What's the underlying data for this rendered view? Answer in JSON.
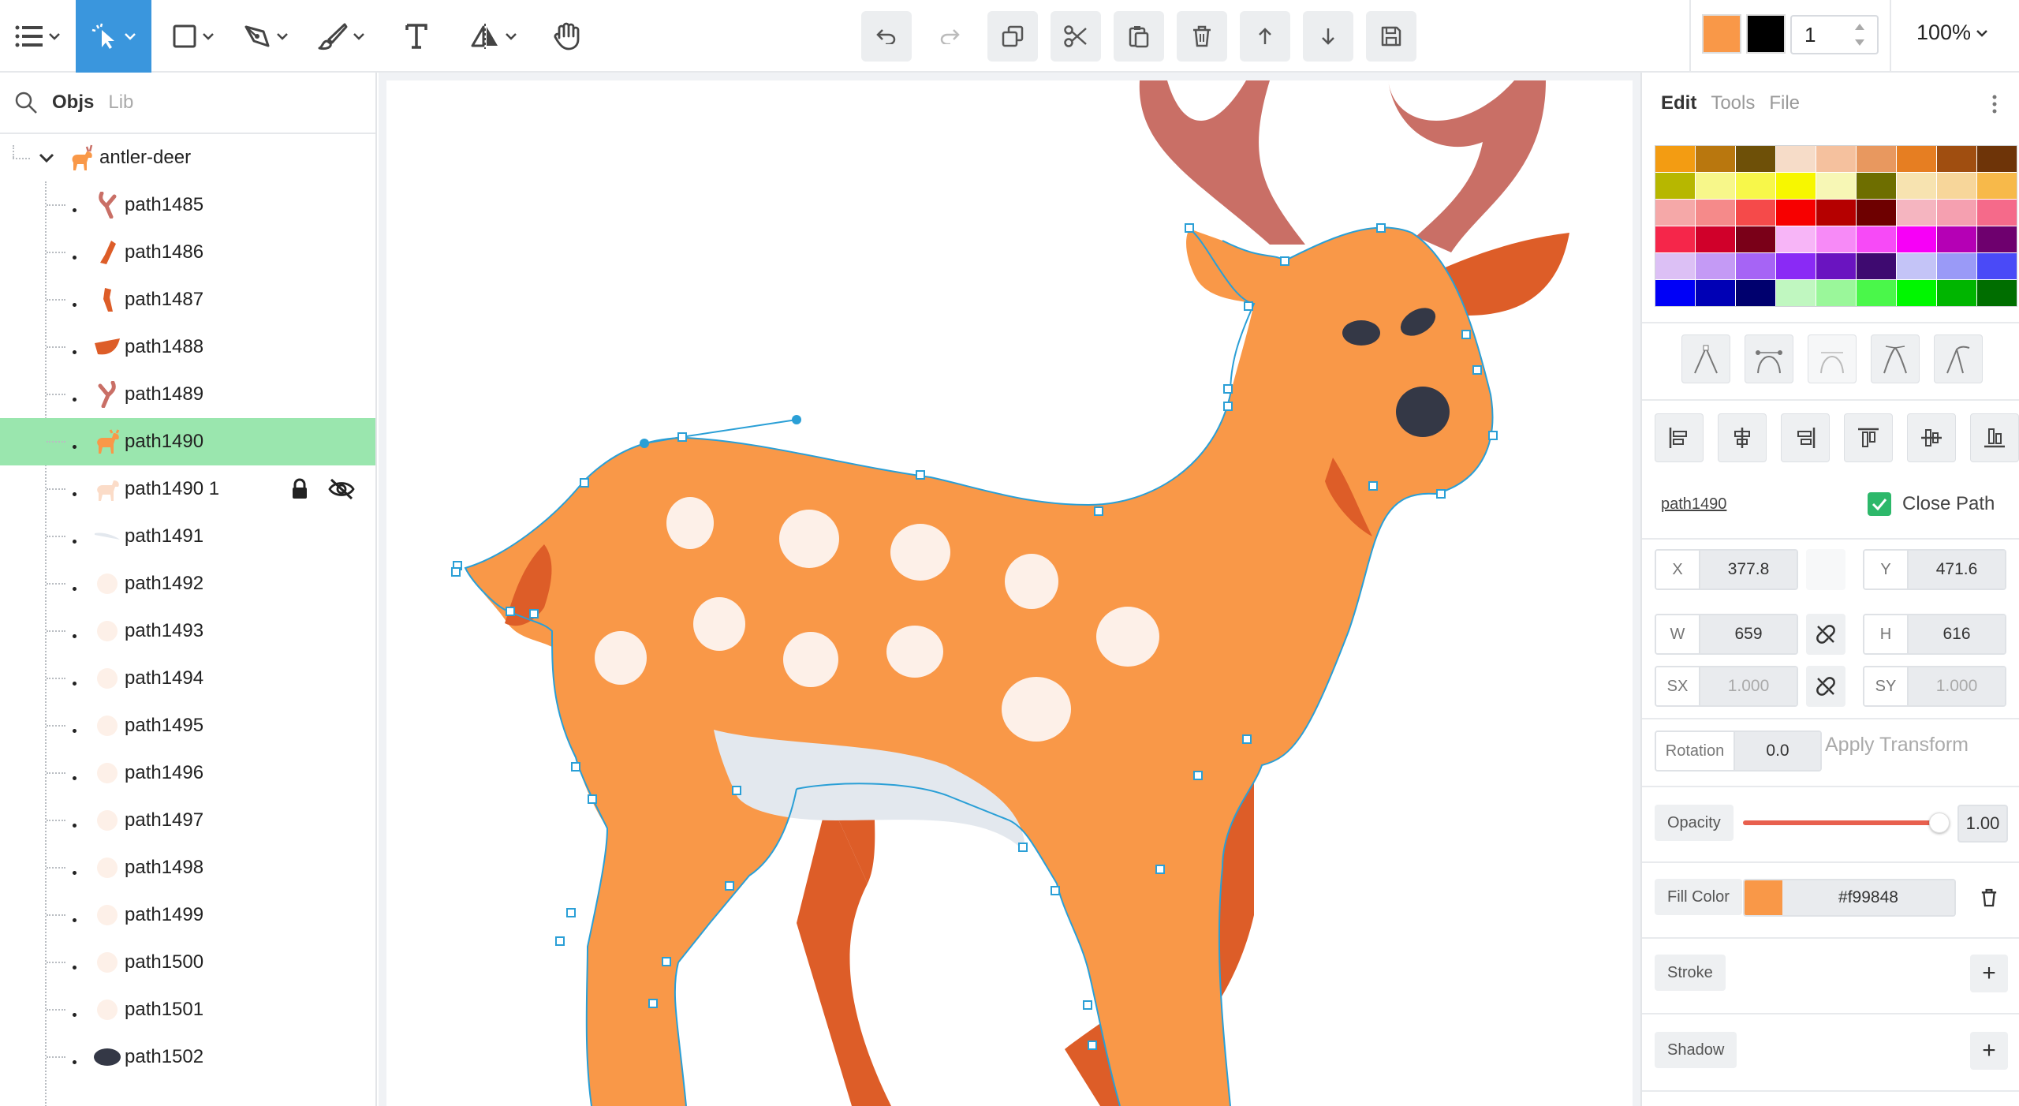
{
  "toolbar": {
    "stroke_width": "1",
    "zoom_label": "100%",
    "fill_color": "#f99848",
    "stroke_color": "#000000",
    "accent": "#3a96dd"
  },
  "left_panel": {
    "tabs": [
      "Objs",
      "Lib"
    ],
    "root": {
      "label": "antler-deer"
    },
    "items": [
      {
        "label": "path1485",
        "thumb": "antler-left"
      },
      {
        "label": "path1486",
        "thumb": "leg-dark"
      },
      {
        "label": "path1487",
        "thumb": "leg-dark-2"
      },
      {
        "label": "path1488",
        "thumb": "ear-shape"
      },
      {
        "label": "path1489",
        "thumb": "antler-right"
      },
      {
        "label": "path1490",
        "thumb": "deer-body",
        "selected": true
      },
      {
        "label": "path1490 1",
        "thumb": "deer-body-faded",
        "locked": true,
        "hidden": true
      },
      {
        "label": "path1491",
        "thumb": "belly"
      },
      {
        "label": "path1492",
        "thumb": "spot"
      },
      {
        "label": "path1493",
        "thumb": "spot"
      },
      {
        "label": "path1494",
        "thumb": "spot"
      },
      {
        "label": "path1495",
        "thumb": "spot"
      },
      {
        "label": "path1496",
        "thumb": "spot"
      },
      {
        "label": "path1497",
        "thumb": "spot"
      },
      {
        "label": "path1498",
        "thumb": "spot"
      },
      {
        "label": "path1499",
        "thumb": "spot"
      },
      {
        "label": "path1500",
        "thumb": "spot"
      },
      {
        "label": "path1501",
        "thumb": "spot"
      },
      {
        "label": "path1502",
        "thumb": "eye"
      }
    ]
  },
  "right_panel": {
    "tabs": [
      "Edit",
      "Tools",
      "File"
    ],
    "palette": [
      "#f39c12",
      "#b9770e",
      "#6e5008",
      "#f6dcc8",
      "#f5c19e",
      "#e8985f",
      "#e67e22",
      "#a04e10",
      "#6e3408",
      "#b7b700",
      "#f7f78a",
      "#f7f74a",
      "#f7f700",
      "#f7f7b5",
      "#6e6e00",
      "#f7e3b0",
      "#f7d69a",
      "#f7b94a",
      "#f5a8a8",
      "#f58a8a",
      "#f54a4a",
      "#f70000",
      "#b50000",
      "#6e0000",
      "#f5b5c0",
      "#f5a0b0",
      "#f56a8a",
      "#f5264a",
      "#d0002a",
      "#7a0018",
      "#f7b5f7",
      "#f78af7",
      "#f74af7",
      "#f700f7",
      "#b500b5",
      "#6e006e",
      "#dcc0f5",
      "#c49af5",
      "#a664f5",
      "#8a2af5",
      "#6a14c0",
      "#3e0a70",
      "#c4c4f7",
      "#9a9af7",
      "#4a4af7",
      "#0000f7",
      "#0000b5",
      "#00006e",
      "#c0f7c0",
      "#9af79a",
      "#4af74a",
      "#00f700",
      "#00b500",
      "#006e00"
    ],
    "object_name": "path1490",
    "close_path_label": "Close Path",
    "x_label": "X",
    "x_value": "377.8",
    "y_label": "Y",
    "y_value": "471.6",
    "w_label": "W",
    "w_value": "659",
    "h_label": "H",
    "h_value": "616",
    "sx_label": "SX",
    "sx_value": "1.000",
    "sy_label": "SY",
    "sy_value": "1.000",
    "rotation_label": "Rotation",
    "rotation_value": "0.0",
    "apply_transform_label": "Apply Transform",
    "opacity_label": "Opacity",
    "opacity_value": "1.00",
    "fill_label": "Fill Color",
    "fill_hex": "#f99848",
    "stroke_label": "Stroke",
    "shadow_label": "Shadow",
    "add_symbol": "+"
  }
}
